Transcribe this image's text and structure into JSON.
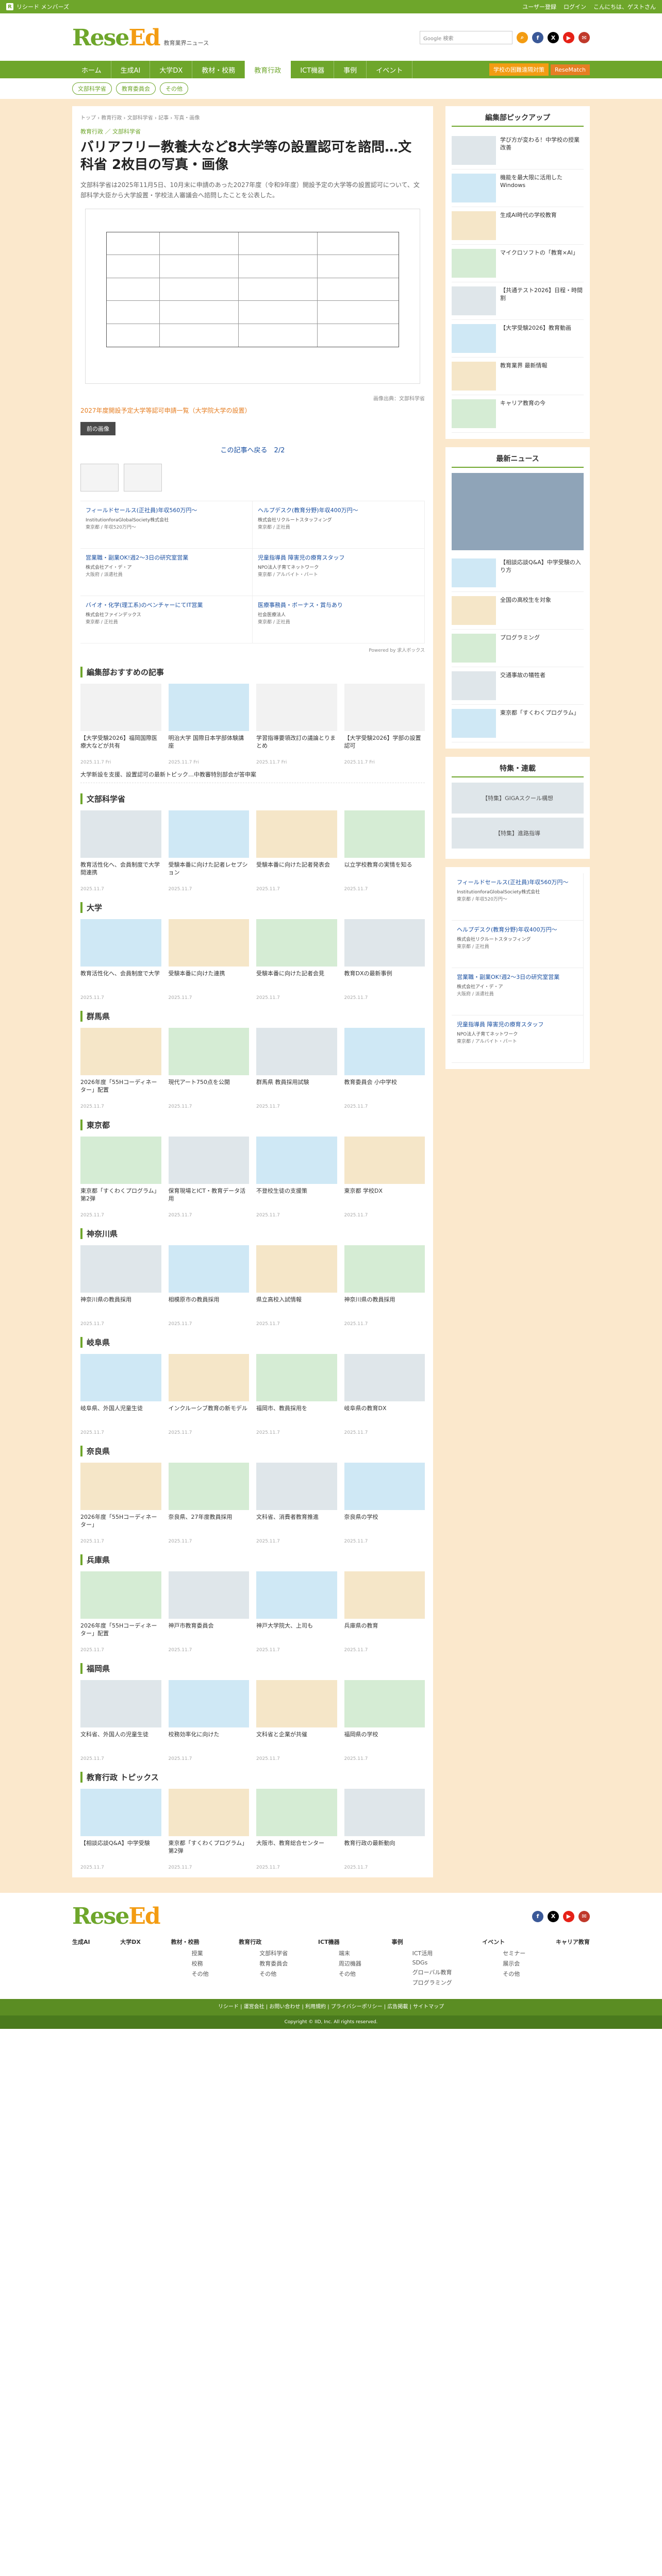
{
  "topbar": {
    "brand": "リシード メンバーズ",
    "links": [
      "ユーザー登録",
      "ログイン",
      "こんにちは、ゲストさん"
    ]
  },
  "header": {
    "logo_a": "Rese",
    "logo_b": "Ed",
    "subtitle": "教育業界ニュース",
    "search_placeholder": "Google 検索"
  },
  "nav": {
    "items": [
      "ホーム",
      "生成AI",
      "大学DX",
      "教材・校務",
      "教育行政",
      "ICT機器",
      "事例",
      "イベント"
    ],
    "current": 3,
    "btn1": "学校の困難遠隔対策",
    "btn2": "ReseMatch"
  },
  "subnav": [
    "文部科学省",
    "教育委員会",
    "その他"
  ],
  "breadcrumb": "トップ › 教育行政 › 文部科学省 › 記事 › 写真・画像",
  "article": {
    "tags": "教育行政 ／ 文部科学省",
    "title": "バリアフリー教養大など8大学等の設置認可を諮問…文科省 2枚目の写真・画像",
    "desc": "文部科学省は2025年11月5日、10月末に申請のあった2027年度（令和9年度）開設予定の大学等の設置認可について、文部科学大臣から大学設置・学校法人審議会へ諮問したことを公表した。",
    "caption": "画像出典：文部科学省",
    "footnote": "2027年度開設予定大学等認可申請一覧（大学院大学の設置）",
    "back": "前の画像",
    "pager": "この記事へ戻る　2/2"
  },
  "ads": [
    {
      "t": "フィールドセールス(正社員)年収560万円〜",
      "c": "InstitutionforaGlobalSociety株式会社",
      "m": "東京都 / 年収520万円〜"
    },
    {
      "t": "ヘルプデスク(教育分野)年収400万円〜",
      "c": "株式会社リクルートスタッフィング",
      "m": "東京都 / 正社員"
    },
    {
      "t": "営業職・副業OK!週2〜3日の研究室営業",
      "c": "株式会社アイ・デ・ア",
      "m": "大阪府 / 派遣社員"
    },
    {
      "t": "児童指導員 障害児の療育スタッフ",
      "c": "NPO法人子育てネットワーク",
      "m": "東京都 / アルバイト・パート"
    },
    {
      "t": "バイオ・化学(理工系)のベンチャーにてIT営業",
      "c": "株式会社ファインデックス",
      "m": "東京都 / 正社員"
    },
    {
      "t": "医療事務員・ボーナス・賞与あり",
      "c": "社会医療法人",
      "m": "東京都 / 正社員"
    }
  ],
  "powered": "Powered by 求人ボックス",
  "recommend": {
    "title": "編集部おすすめの記事",
    "cards": [
      {
        "t": "【大学受験2026】福岡国際医療大などが共有",
        "d": "2025.11.7 Fri"
      },
      {
        "t": "明治大学 国際日本学部体験講座",
        "d": "2025.11.7 Fri"
      },
      {
        "t": "学習指導要領改訂の議論とりまとめ",
        "d": "2025.11.7 Fri"
      },
      {
        "t": "【大学受験2026】学部の設置認可",
        "d": "2025.11.7 Fri"
      }
    ],
    "link": "大学新設を支援、設置認可の最新トピック…中教審特別部会が答申案"
  },
  "sections": [
    {
      "title": "文部科学省",
      "cards": [
        {
          "t": "教育活性化へ、会員制度で大学間連携",
          "d": "2025.11.7"
        },
        {
          "t": "受験本番に向けた記者レセプション",
          "d": "2025.11.7"
        },
        {
          "t": "受験本番に向けた記者発表会",
          "d": "2025.11.7"
        },
        {
          "t": "以立学校教育の実情を知る",
          "d": "2025.11.7"
        }
      ]
    },
    {
      "title": "大学",
      "cards": [
        {
          "t": "教育活性化へ、会員制度で大学",
          "d": "2025.11.7"
        },
        {
          "t": "受験本番に向けた連携",
          "d": "2025.11.7"
        },
        {
          "t": "受験本番に向けた記者会見",
          "d": "2025.11.7"
        },
        {
          "t": "教育DXの最新事例",
          "d": "2025.11.7"
        }
      ]
    },
    {
      "title": "群馬県",
      "cards": [
        {
          "t": "2026年度「55Hコーディネーター」配置",
          "d": "2025.11.7"
        },
        {
          "t": "現代アート750点を公開",
          "d": "2025.11.7"
        },
        {
          "t": "群馬県 教員採用試験",
          "d": "2025.11.7"
        },
        {
          "t": "教育委員会 小中学校",
          "d": "2025.11.7"
        }
      ]
    },
    {
      "title": "東京都",
      "cards": [
        {
          "t": "東京都「すくわくプログラム」第2弾",
          "d": "2025.11.7"
        },
        {
          "t": "保育現場とICT・教育データ活用",
          "d": "2025.11.7"
        },
        {
          "t": "不登校生徒の支援策",
          "d": "2025.11.7"
        },
        {
          "t": "東京都 学校DX",
          "d": "2025.11.7"
        }
      ]
    },
    {
      "title": "神奈川県",
      "cards": [
        {
          "t": "神奈川県の教員採用",
          "d": "2025.11.7"
        },
        {
          "t": "相模原市の教員採用",
          "d": "2025.11.7"
        },
        {
          "t": "県立高校入試情報",
          "d": "2025.11.7"
        },
        {
          "t": "神奈川県の教員採用",
          "d": "2025.11.7"
        }
      ]
    },
    {
      "title": "岐阜県",
      "cards": [
        {
          "t": "岐阜県、外国人児童生徒",
          "d": "2025.11.7"
        },
        {
          "t": "インクルーシブ教育の新モデル",
          "d": "2025.11.7"
        },
        {
          "t": "福岡市、教員採用を",
          "d": "2025.11.7"
        },
        {
          "t": "岐阜県の教育DX",
          "d": "2025.11.7"
        }
      ]
    },
    {
      "title": "奈良県",
      "cards": [
        {
          "t": "2026年度「55Hコーディネーター」",
          "d": "2025.11.7"
        },
        {
          "t": "奈良県、27年度教員採用",
          "d": "2025.11.7"
        },
        {
          "t": "文科省、消費者教育推進",
          "d": "2025.11.7"
        },
        {
          "t": "奈良県の学校",
          "d": "2025.11.7"
        }
      ]
    },
    {
      "title": "兵庫県",
      "cards": [
        {
          "t": "2026年度「55Hコーディネーター」配置",
          "d": "2025.11.7"
        },
        {
          "t": "神戸市教育委員会",
          "d": "2025.11.7"
        },
        {
          "t": "神戸大学院大、上司も",
          "d": "2025.11.7"
        },
        {
          "t": "兵庫県の教育",
          "d": "2025.11.7"
        }
      ]
    },
    {
      "title": "福岡県",
      "cards": [
        {
          "t": "文科省、外国人の児童生徒",
          "d": "2025.11.7"
        },
        {
          "t": "校務効率化に向けた",
          "d": "2025.11.7"
        },
        {
          "t": "文科省と企業が共催",
          "d": "2025.11.7"
        },
        {
          "t": "福岡県の学校",
          "d": "2025.11.7"
        }
      ]
    },
    {
      "title": "教育行政 トピックス",
      "cards": [
        {
          "t": "【相談応談Q&A】中学受験",
          "d": "2025.11.7"
        },
        {
          "t": "東京都「すくわくプログラム」第2弾",
          "d": "2025.11.7"
        },
        {
          "t": "大阪市、教育総合センター",
          "d": "2025.11.7"
        },
        {
          "t": "教育行政の最新動向",
          "d": "2025.11.7"
        }
      ]
    }
  ],
  "side": {
    "pickup_title": "編集部ピックアップ",
    "picks": [
      "学び方が変わる！中学校の授業改善",
      "機能を最大限に活用したWindows",
      "生成AI時代の学校教育",
      "マイクロソフトの「教育×AI」",
      "【共通テスト2026】日程・時間割",
      "【大学受験2026】教育動画",
      "教育業界 最新情報",
      "キャリア教育の今"
    ],
    "news_title": "最新ニュース",
    "news": [
      "【相談応談Q&A】中学受験の入り方",
      "全国の高校生を対象",
      "プログラミング",
      "交通事故の犠牲者",
      "東京都「すくわくプログラム」"
    ],
    "feature_title": "特集・連載",
    "features": [
      "【特集】GIGAスクール構想",
      "【特集】進路指導"
    ]
  },
  "footer": {
    "cols": [
      {
        "h": "生成AI",
        "items": []
      },
      {
        "h": "大学DX",
        "items": []
      },
      {
        "h": "教材・校務",
        "items": [
          "授業",
          "校務",
          "その他"
        ]
      },
      {
        "h": "教育行政",
        "items": [
          "文部科学省",
          "教育委員会",
          "その他"
        ]
      },
      {
        "h": "ICT機器",
        "items": [
          "端末",
          "周辺機器",
          "その他"
        ]
      },
      {
        "h": "事例",
        "items": [
          "ICT活用",
          "SDGs",
          "グローバル教育",
          "プログラミング"
        ]
      },
      {
        "h": "イベント",
        "items": [
          "セミナー",
          "展示会",
          "その他"
        ]
      },
      {
        "h": "キャリア教育",
        "items": []
      }
    ],
    "bottom": "リシード | 運営会社 | お問い合わせ | 利用規約 | プライバシーポリシー | 広告掲載 | サイトマップ",
    "copy": "Copyright © IID, Inc. All rights reserved."
  }
}
